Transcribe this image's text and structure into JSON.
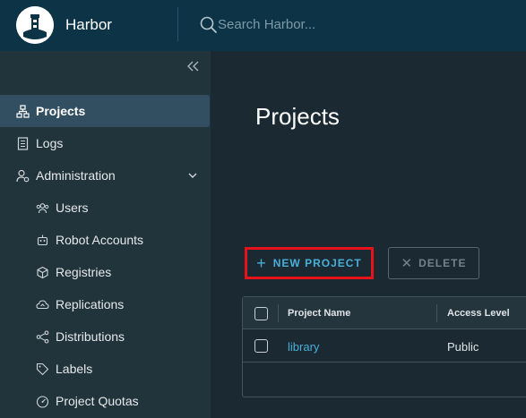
{
  "header": {
    "brand": "Harbor",
    "search_placeholder": "Search Harbor..."
  },
  "sidebar": {
    "items": [
      {
        "label": "Projects",
        "icon": "projects-icon",
        "active": true
      },
      {
        "label": "Logs",
        "icon": "logs-icon"
      },
      {
        "label": "Administration",
        "icon": "administration-icon",
        "expanded": true
      },
      {
        "label": "Users",
        "icon": "users-icon"
      },
      {
        "label": "Robot Accounts",
        "icon": "robot-icon"
      },
      {
        "label": "Registries",
        "icon": "registries-icon"
      },
      {
        "label": "Replications",
        "icon": "replications-icon"
      },
      {
        "label": "Distributions",
        "icon": "distributions-icon"
      },
      {
        "label": "Labels",
        "icon": "labels-icon"
      },
      {
        "label": "Project Quotas",
        "icon": "quotas-icon"
      }
    ]
  },
  "main": {
    "title": "Projects",
    "new_project_label": "NEW PROJECT",
    "delete_label": "DELETE",
    "table": {
      "columns": [
        "Project Name",
        "Access Level"
      ],
      "rows": [
        {
          "name": "library",
          "access": "Public"
        }
      ]
    }
  },
  "colors": {
    "header_bg": "#0d3446",
    "sidebar_bg": "#21333b",
    "active_item_bg": "#324f62",
    "main_bg": "#1b2a32",
    "accent": "#49afd9",
    "highlight_box": "#e8121b"
  }
}
